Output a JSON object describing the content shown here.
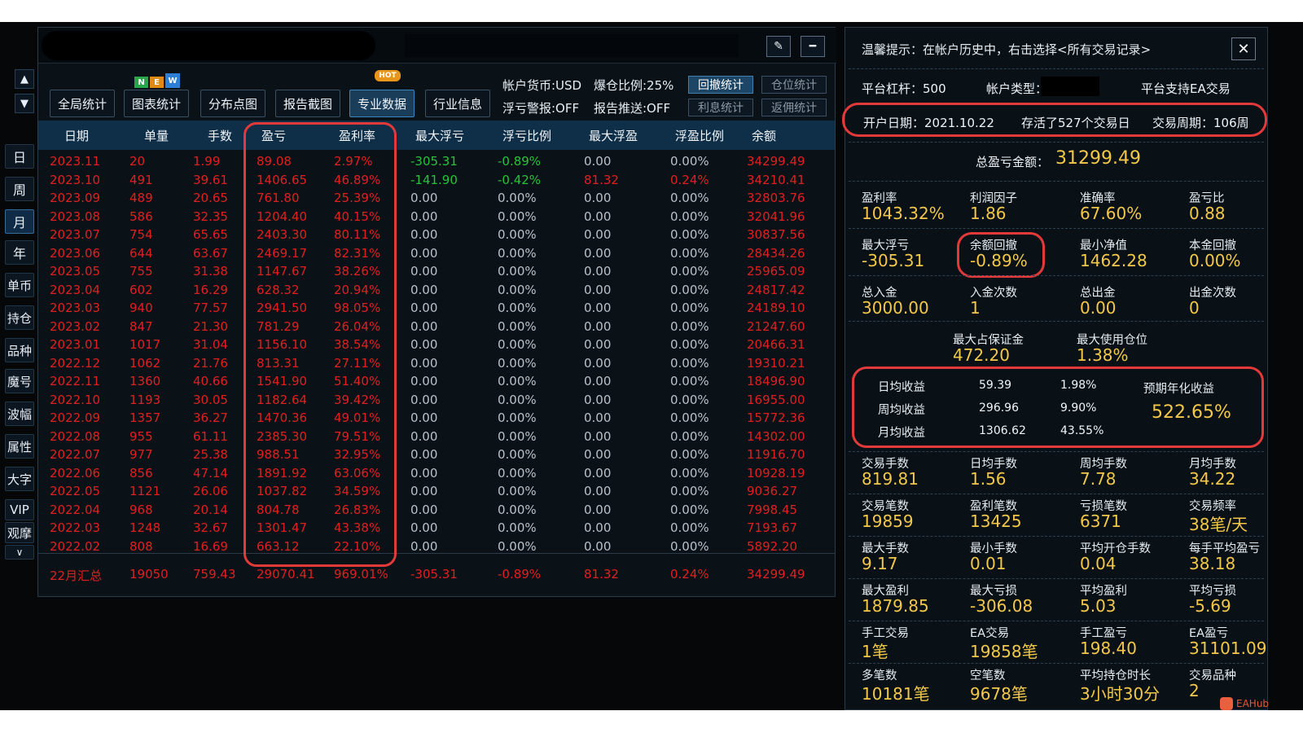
{
  "nav": {
    "up": "▲",
    "down": "▼",
    "items": [
      "日",
      "周",
      "月",
      "年",
      "单币",
      "持仓",
      "品种",
      "魔号",
      "波幅",
      "属性",
      "大字",
      "VIP",
      "观摩"
    ],
    "more": "∨"
  },
  "window": {
    "edit_icon": "✎",
    "min_icon": "━"
  },
  "toolbar": {
    "buttons": [
      "全局统计",
      "图表统计",
      "分布点图",
      "报告截图",
      "专业数据",
      "行业信息"
    ],
    "new_badge": [
      "N",
      "E",
      "W"
    ],
    "hot_badge": "HOT"
  },
  "info": {
    "currency": "帐户货币:USD",
    "position_ratio": "爆仓比例:25%",
    "float_alert": "浮亏警报:OFF",
    "report_push": "报告推送:OFF"
  },
  "side_buttons": [
    "回撤统计",
    "仓位统计",
    "利息统计",
    "返佣统计"
  ],
  "table": {
    "headers": [
      "日期",
      "单量",
      "手数",
      "盈亏",
      "盈利率",
      "最大浮亏",
      "浮亏比例",
      "最大浮盈",
      "浮盈比例",
      "余额"
    ],
    "rows": [
      [
        "2023.11",
        "20",
        "1.99",
        "89.08",
        "2.97%",
        "-305.31",
        "-0.89%",
        "0.00",
        "0.00%",
        "34299.49"
      ],
      [
        "2023.10",
        "491",
        "39.61",
        "1406.65",
        "46.89%",
        "-141.90",
        "-0.42%",
        "81.32",
        "0.24%",
        "34210.41"
      ],
      [
        "2023.09",
        "489",
        "20.65",
        "761.80",
        "25.39%",
        "0.00",
        "0.00%",
        "0.00",
        "0.00%",
        "32803.76"
      ],
      [
        "2023.08",
        "586",
        "32.35",
        "1204.40",
        "40.15%",
        "0.00",
        "0.00%",
        "0.00",
        "0.00%",
        "32041.96"
      ],
      [
        "2023.07",
        "754",
        "65.65",
        "2403.30",
        "80.11%",
        "0.00",
        "0.00%",
        "0.00",
        "0.00%",
        "30837.56"
      ],
      [
        "2023.06",
        "644",
        "63.67",
        "2469.17",
        "82.31%",
        "0.00",
        "0.00%",
        "0.00",
        "0.00%",
        "28434.26"
      ],
      [
        "2023.05",
        "755",
        "31.38",
        "1147.67",
        "38.26%",
        "0.00",
        "0.00%",
        "0.00",
        "0.00%",
        "25965.09"
      ],
      [
        "2023.04",
        "602",
        "16.29",
        "628.32",
        "20.94%",
        "0.00",
        "0.00%",
        "0.00",
        "0.00%",
        "24817.42"
      ],
      [
        "2023.03",
        "940",
        "77.57",
        "2941.50",
        "98.05%",
        "0.00",
        "0.00%",
        "0.00",
        "0.00%",
        "24189.10"
      ],
      [
        "2023.02",
        "847",
        "21.30",
        "781.29",
        "26.04%",
        "0.00",
        "0.00%",
        "0.00",
        "0.00%",
        "21247.60"
      ],
      [
        "2023.01",
        "1017",
        "31.04",
        "1156.10",
        "38.54%",
        "0.00",
        "0.00%",
        "0.00",
        "0.00%",
        "20466.31"
      ],
      [
        "2022.12",
        "1062",
        "21.76",
        "813.31",
        "27.11%",
        "0.00",
        "0.00%",
        "0.00",
        "0.00%",
        "19310.21"
      ],
      [
        "2022.11",
        "1360",
        "40.66",
        "1541.90",
        "51.40%",
        "0.00",
        "0.00%",
        "0.00",
        "0.00%",
        "18496.90"
      ],
      [
        "2022.10",
        "1193",
        "30.05",
        "1182.64",
        "39.42%",
        "0.00",
        "0.00%",
        "0.00",
        "0.00%",
        "16955.00"
      ],
      [
        "2022.09",
        "1357",
        "36.27",
        "1470.36",
        "49.01%",
        "0.00",
        "0.00%",
        "0.00",
        "0.00%",
        "15772.36"
      ],
      [
        "2022.08",
        "955",
        "61.11",
        "2385.30",
        "79.51%",
        "0.00",
        "0.00%",
        "0.00",
        "0.00%",
        "14302.00"
      ],
      [
        "2022.07",
        "977",
        "25.38",
        "988.51",
        "32.95%",
        "0.00",
        "0.00%",
        "0.00",
        "0.00%",
        "11916.70"
      ],
      [
        "2022.06",
        "856",
        "47.14",
        "1891.92",
        "63.06%",
        "0.00",
        "0.00%",
        "0.00",
        "0.00%",
        "10928.19"
      ],
      [
        "2022.05",
        "1121",
        "26.06",
        "1037.82",
        "34.59%",
        "0.00",
        "0.00%",
        "0.00",
        "0.00%",
        "9036.27"
      ],
      [
        "2022.04",
        "968",
        "20.14",
        "804.78",
        "26.83%",
        "0.00",
        "0.00%",
        "0.00",
        "0.00%",
        "7998.45"
      ],
      [
        "2022.03",
        "1248",
        "32.67",
        "1301.47",
        "43.38%",
        "0.00",
        "0.00%",
        "0.00",
        "0.00%",
        "7193.67"
      ],
      [
        "2022.02",
        "808",
        "16.69",
        "663.12",
        "22.10%",
        "0.00",
        "0.00%",
        "0.00",
        "0.00%",
        "5892.20"
      ]
    ],
    "summary": [
      "22月汇总",
      "19050",
      "759.43",
      "29070.41",
      "969.01%",
      "-305.31",
      "-0.89%",
      "81.32",
      "0.24%",
      "34299.49"
    ]
  },
  "right": {
    "tip": "温馨提示：在帐户历史中，右击选择<所有交易记录>",
    "close": "✕",
    "leverage": "平台杠杆：500",
    "account_type": "帐户类型：",
    "ea_support": "平台支持EA交易",
    "open_date": "开户日期：2021.10.22",
    "alive_days": "存活了527个交易日",
    "trade_weeks": "交易周期：106周",
    "total_pl_label": "总盈亏金额：",
    "total_pl_value": "31299.49",
    "grid1": [
      {
        "label": "盈利率",
        "value": "1043.32%"
      },
      {
        "label": "利润因子",
        "value": "1.86"
      },
      {
        "label": "准确率",
        "value": "67.60%"
      },
      {
        "label": "盈亏比",
        "value": "0.88"
      },
      {
        "label": "最大浮亏",
        "value": "-305.31"
      },
      {
        "label": "余额回撤",
        "value": "-0.89%"
      },
      {
        "label": "最小净值",
        "value": "1462.28"
      },
      {
        "label": "本金回撤",
        "value": "0.00%"
      },
      {
        "label": "总入金",
        "value": "3000.00"
      },
      {
        "label": "入金次数",
        "value": "1"
      },
      {
        "label": "总出金",
        "value": "0.00"
      },
      {
        "label": "出金次数",
        "value": "0"
      }
    ],
    "margin": [
      {
        "label": "最大占保证金",
        "value": "472.20"
      },
      {
        "label": "最大使用仓位",
        "value": "1.38%"
      }
    ],
    "income": [
      {
        "label": "日均收益",
        "amount": "59.39",
        "pct": "1.98%"
      },
      {
        "label": "周均收益",
        "amount": "296.96",
        "pct": "9.90%"
      },
      {
        "label": "月均收益",
        "amount": "1306.62",
        "pct": "43.55%"
      }
    ],
    "annual_label": "预期年化收益",
    "annual_value": "522.65%",
    "grid2": [
      {
        "label": "交易手数",
        "value": "819.81"
      },
      {
        "label": "日均手数",
        "value": "1.56"
      },
      {
        "label": "周均手数",
        "value": "7.78"
      },
      {
        "label": "月均手数",
        "value": "34.22"
      },
      {
        "label": "交易笔数",
        "value": "19859"
      },
      {
        "label": "盈利笔数",
        "value": "13425"
      },
      {
        "label": "亏损笔数",
        "value": "6371"
      },
      {
        "label": "交易频率",
        "value": "38笔/天"
      },
      {
        "label": "最大手数",
        "value": "9.17"
      },
      {
        "label": "最小手数",
        "value": "0.01"
      },
      {
        "label": "平均开仓手数",
        "value": "0.04"
      },
      {
        "label": "每手平均盈亏",
        "value": "38.18"
      },
      {
        "label": "最大盈利",
        "value": "1879.85"
      },
      {
        "label": "最大亏损",
        "value": "-306.08"
      },
      {
        "label": "平均盈利",
        "value": "5.03"
      },
      {
        "label": "平均亏损",
        "value": "-5.69"
      },
      {
        "label": "手工交易",
        "value": "1笔"
      },
      {
        "label": "EA交易",
        "value": "19858笔"
      },
      {
        "label": "手工盈亏",
        "value": "198.40"
      },
      {
        "label": "EA盈亏",
        "value": "31101.09"
      },
      {
        "label": "多笔数",
        "value": "10181笔"
      },
      {
        "label": "空笔数",
        "value": "9678笔"
      },
      {
        "label": "平均持仓时长",
        "value": "3小时30分"
      },
      {
        "label": "交易品种",
        "value": "2"
      }
    ]
  },
  "watermark": "EAHub",
  "colors": {
    "loss_red": "#e02020",
    "value_gold": "#f2c84b",
    "highlight": "#e23a3a",
    "float_green": "#28c23a"
  }
}
